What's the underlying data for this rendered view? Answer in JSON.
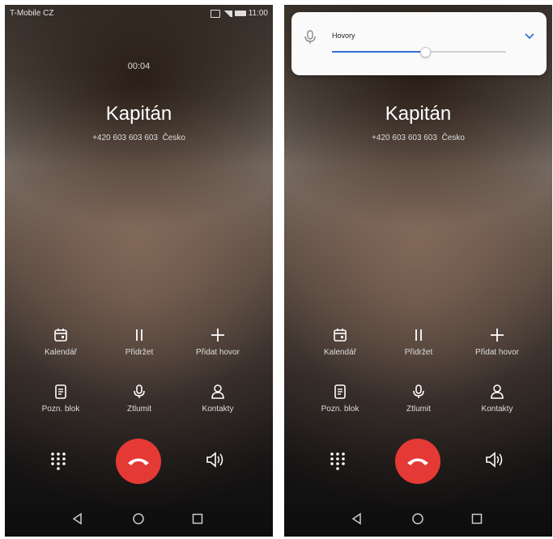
{
  "colors": {
    "end_call": "#e53935",
    "accent": "#2f6fd6"
  },
  "left_screen": {
    "status_bar": {
      "carrier": "T-Mobile CZ",
      "time": "11:00",
      "icons": [
        "nfc-icon",
        "signal-icon",
        "battery-icon"
      ]
    },
    "call_timer": "00:04",
    "caller": {
      "name": "Kapitán",
      "number": "+420 603 603 603",
      "location": "Česko"
    },
    "actions": [
      {
        "label": "Kalendář",
        "icon": "calendar-icon"
      },
      {
        "label": "Přidržet",
        "icon": "pause-icon"
      },
      {
        "label": "Přidat hovor",
        "icon": "plus-icon"
      },
      {
        "label": "Pozn. blok",
        "icon": "notepad-icon"
      },
      {
        "label": "Ztlumit",
        "icon": "microphone-icon"
      },
      {
        "label": "Kontakty",
        "icon": "contact-icon"
      }
    ]
  },
  "right_screen": {
    "volume_panel": {
      "label": "Hovory",
      "level": 0.53,
      "icon": "microphone-icon",
      "expand_icon": "chevron-down-icon"
    },
    "caller": {
      "name": "Kapitán",
      "number": "+420 603 603 603",
      "location": "Česko"
    },
    "actions": [
      {
        "label": "Kalendář",
        "icon": "calendar-icon"
      },
      {
        "label": "Přidržet",
        "icon": "pause-icon"
      },
      {
        "label": "Přidat hovor",
        "icon": "plus-icon"
      },
      {
        "label": "Pozn. blok",
        "icon": "notepad-icon"
      },
      {
        "label": "Ztlumit",
        "icon": "microphone-icon"
      },
      {
        "label": "Kontakty",
        "icon": "contact-icon"
      }
    ]
  }
}
